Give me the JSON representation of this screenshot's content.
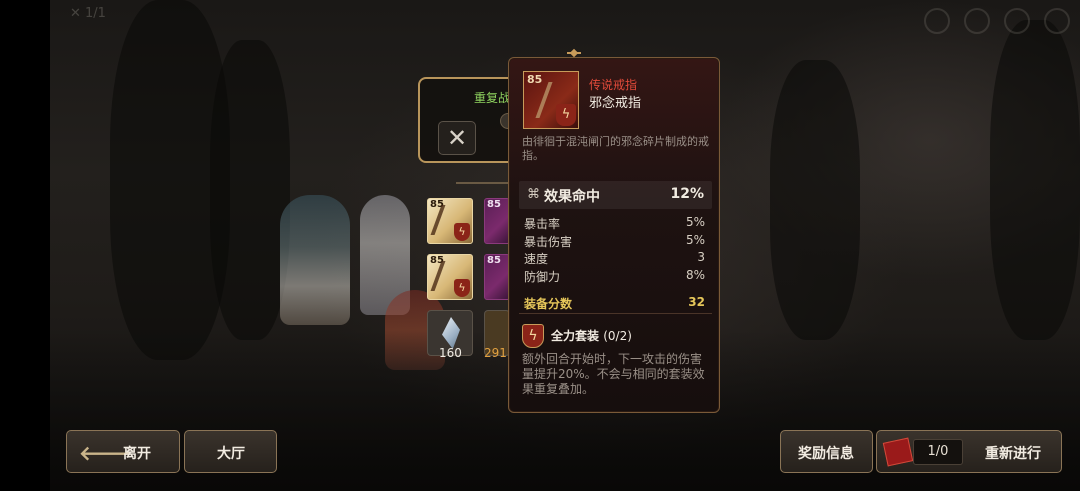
{
  "top_bar": {
    "faint_indicator": "✕ 1/1"
  },
  "repeat_panel": {
    "title": "重复战",
    "close_icon": "close-icon"
  },
  "rewards": {
    "items": [
      {
        "level": "85",
        "rarity": "legend",
        "set_icon": "lightning-set-icon"
      },
      {
        "level": "85",
        "rarity": "heroic",
        "set_icon": "lightning-set-icon"
      },
      {
        "level": "85",
        "rarity": "legend",
        "set_icon": "lightning-set-icon"
      },
      {
        "level": "85",
        "rarity": "heroic",
        "set_icon": "lightning-set-icon"
      }
    ],
    "materials": [
      {
        "count": "160",
        "icon": "crystal-icon"
      },
      {
        "count": "291",
        "icon": "gold-coin-icon"
      }
    ]
  },
  "tooltip": {
    "level": "85",
    "rarity_label": "传说戒指",
    "name": "邪念戒指",
    "description": "由徘徊于混沌闸门的邪念碎片制成的戒指。",
    "main_stat": {
      "icon": "effectiveness-icon",
      "name": "效果命中",
      "value": "12%"
    },
    "sub_stats": [
      {
        "name": "暴击率",
        "value": "5%"
      },
      {
        "name": "暴击伤害",
        "value": "5%"
      },
      {
        "name": "速度",
        "value": "3"
      },
      {
        "name": "防御力",
        "value": "8%"
      }
    ],
    "score": {
      "label": "装备分数",
      "value": "32"
    },
    "set": {
      "name": "全力套装",
      "count": "(0/2)",
      "description": "额外回合开始时，下一攻击的伤害量提升20%。不会与相同的套装效果重复叠加。"
    }
  },
  "buttons": {
    "leave": "离开",
    "lobby": "大厅",
    "reward_info": "奖励信息",
    "retry_count": "1/0",
    "retry": "重新进行"
  },
  "colors": {
    "rarity_legend": "#e14a3a",
    "score": "#e5c65a",
    "repeat_title": "#8fd35f",
    "gold_border": "#b8955b"
  }
}
